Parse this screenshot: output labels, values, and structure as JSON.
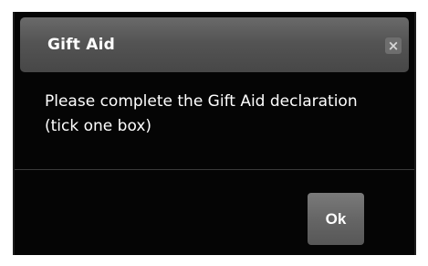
{
  "dialog": {
    "title": "Gift Aid",
    "close_glyph": "×",
    "close_icon": "close-icon",
    "message": "Please complete the Gift Aid declaration (tick one box)",
    "ok_label": "Ok"
  },
  "colors": {
    "dialog_background": "#050505",
    "titlebar": "#5a5a5a",
    "button": "#666666",
    "text": "#ffffff"
  }
}
